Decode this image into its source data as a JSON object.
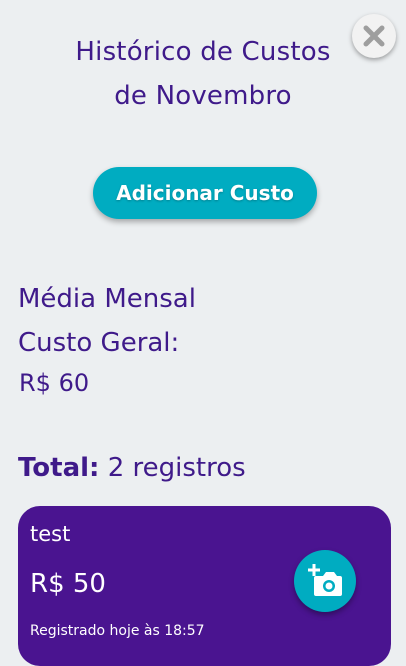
{
  "header": {
    "title_line1": "Histórico de Custos",
    "title_line2": "de Novembro",
    "close_icon": "close-x-icon"
  },
  "actions": {
    "add_cost_label": "Adicionar Custo"
  },
  "summary": {
    "average_label_line1": "Média Mensal",
    "average_label_line2": "Custo Geral:",
    "average_value": "R$ 60",
    "total_label": "Total:",
    "total_value": "2 registros"
  },
  "records": [
    {
      "name": "test",
      "value": "R$ 50",
      "registered": "Registrado hoje às 18:57",
      "action_icon": "add-photo-icon"
    }
  ],
  "colors": {
    "background": "#eceff1",
    "primary_text": "#3f1a8a",
    "accent": "#00acc1",
    "card": "#4a1490"
  }
}
